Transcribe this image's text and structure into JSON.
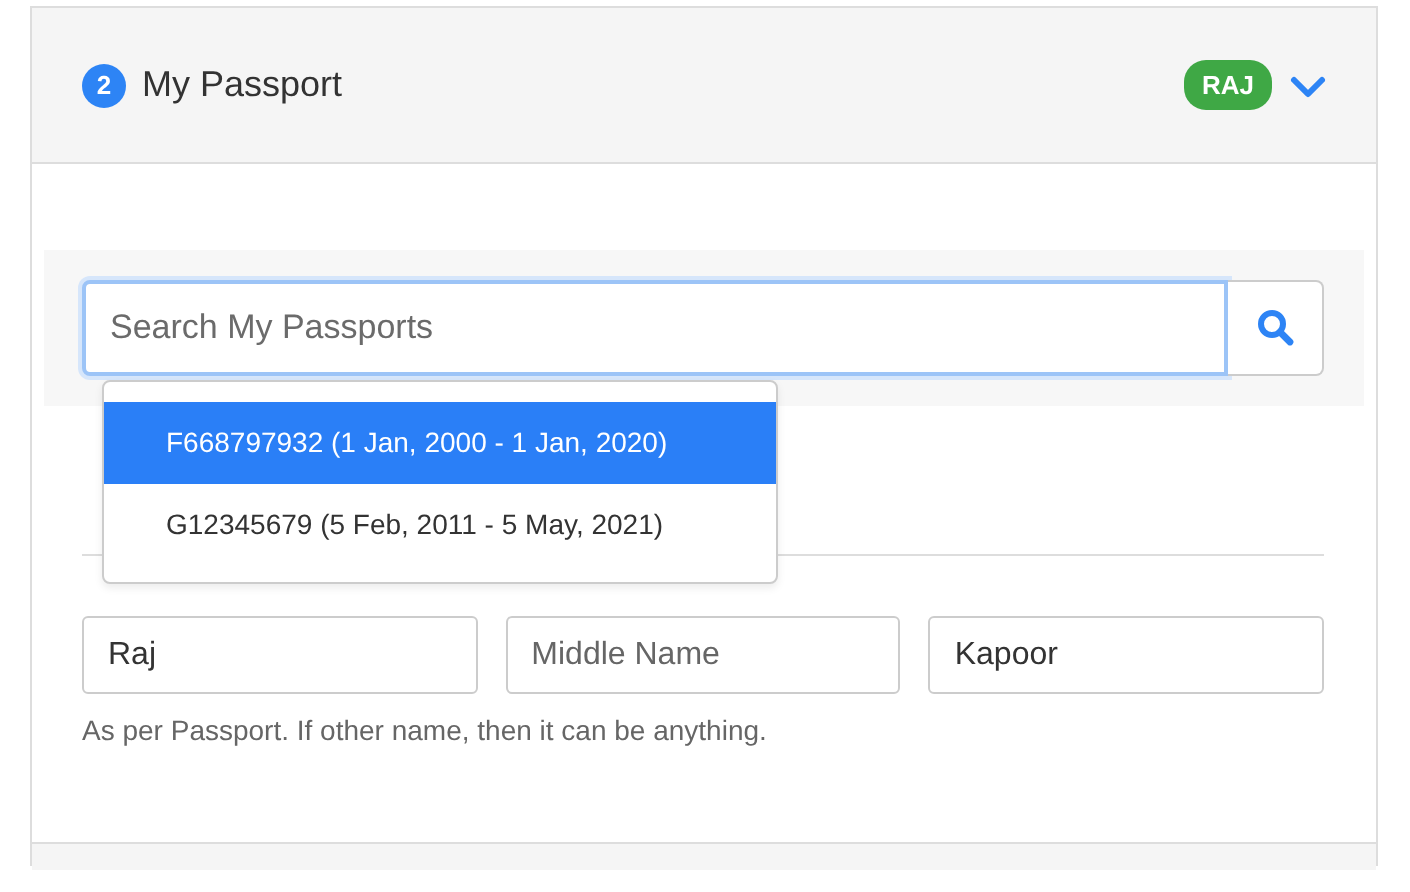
{
  "step": {
    "number": "2",
    "title": "My Passport",
    "badge": "RAJ",
    "expanded": true
  },
  "search": {
    "placeholder": "Search My Passports"
  },
  "suggestions": [
    {
      "label": "F668797932 (1 Jan, 2000 - 1 Jan, 2020)",
      "selected": true
    },
    {
      "label": "G12345679 (5 Feb, 2011 - 5 May, 2021)",
      "selected": false
    }
  ],
  "name_fields": [
    {
      "value": "Raj"
    },
    {
      "placeholder": "Middle Name"
    },
    {
      "value": "Kapoor"
    }
  ],
  "help_text": "As per Passport. If other name, then it can be anything."
}
